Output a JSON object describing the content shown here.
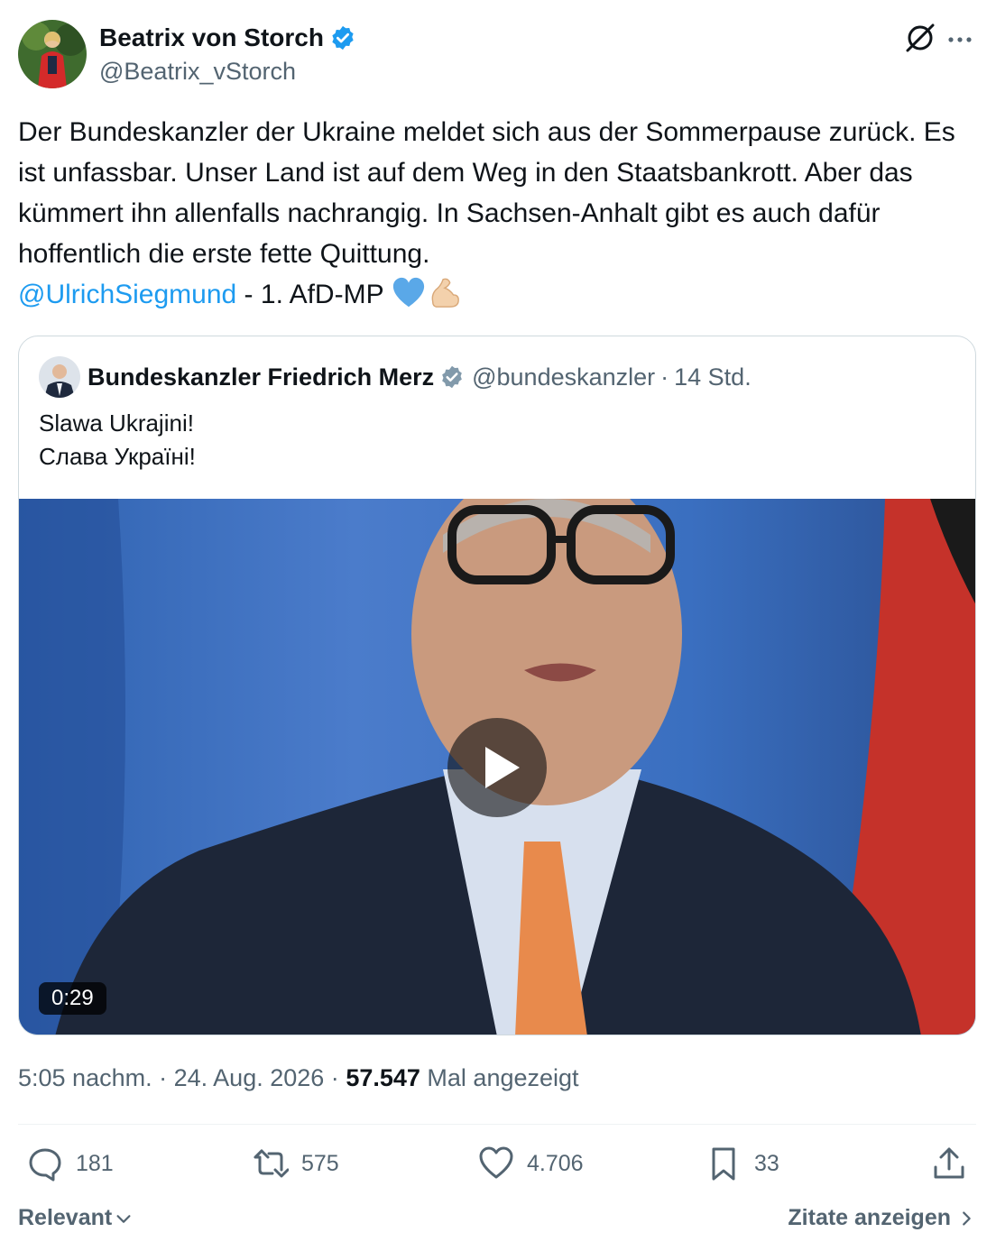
{
  "author": {
    "name": "Beatrix von Storch",
    "handle": "@Beatrix_vStorch"
  },
  "tweet": {
    "text": "Der Bundeskanzler der Ukraine meldet sich aus der Sommerpause zurück. Es ist unfassbar. Unser Land ist auf dem Weg in den Staatsbankrott. Aber das kümmert ihn allenfalls nachrangig. In Sachsen-Anhalt gibt es auch dafür hoffentlich die erste fette Quittung.",
    "mention": "@UlrichSiegmund",
    "suffix": " - 1. AfD-MP ",
    "emojis": [
      "blue-heart",
      "flexed-biceps"
    ]
  },
  "quote": {
    "name": "Bundeskanzler Friedrich Merz",
    "handle": "@bundeskanzler",
    "separator": "·",
    "time": "14 Std.",
    "line1": "Slawa Ukrajini!",
    "line2": "Слава Україні!",
    "video_duration": "0:29"
  },
  "meta": {
    "time": "5:05 nachm.",
    "separator": "·",
    "date": "24. Aug. 2026",
    "views_count": "57.547",
    "views_label": "Mal angezeigt"
  },
  "actions": {
    "replies": "181",
    "reposts": "575",
    "likes": "4.706",
    "bookmarks": "33"
  },
  "footer": {
    "sort_label": "Relevant",
    "quotes_label": "Zitate anzeigen"
  },
  "colors": {
    "accent": "#1d9bf0",
    "text": "#0f1419",
    "muted": "#536471",
    "border": "#cfd9de"
  }
}
